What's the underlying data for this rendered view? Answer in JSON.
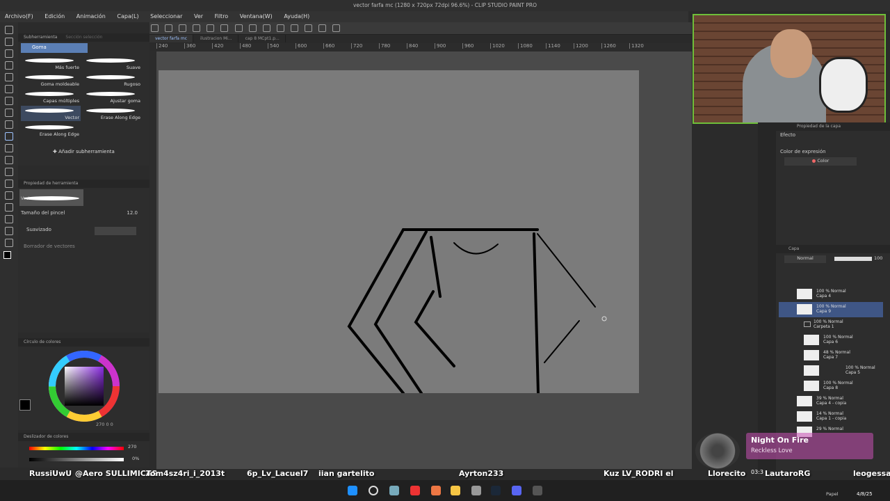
{
  "window": {
    "title": "vector farfa mc (1280 x 720px 72dpi 96.6%) - CLIP STUDIO PAINT PRO"
  },
  "menu": [
    "Archivo(F)",
    "Edición",
    "Animación",
    "Capa(L)",
    "Seleccionar",
    "Ver",
    "Filtro",
    "Ventana(W)",
    "Ayuda(H)"
  ],
  "tabs": [
    "vector farfa mc",
    "ilustracion Mi...",
    "cap 8 MCpt1.p..."
  ],
  "ruler": [
    "240",
    "360",
    "420",
    "480",
    "540",
    "600",
    "660",
    "720",
    "780",
    "840",
    "900",
    "960",
    "1020",
    "1080",
    "1140",
    "1200",
    "1260",
    "1320"
  ],
  "subtool": {
    "tabs": [
      "Subherramienta",
      "Sección selección"
    ],
    "group": "Goma",
    "brushes": [
      "Más fuerte",
      "Suave",
      "Goma moldeable",
      "Rugoso",
      "Capas múltiples",
      "Ajustar goma",
      "Vector",
      "Erase Along Edge",
      "Erase Along Edge"
    ],
    "add": "Añadir subherramienta"
  },
  "toolprop": {
    "title": "Propiedad de herramienta",
    "preset": "Vector",
    "size_label": "Tamaño del pincel",
    "size_value": "12.0",
    "smooth_label": "Suavizado",
    "vector_label": "Borrador de vectores"
  },
  "color": {
    "title": "Círculo de colores",
    "readout": "270  0  0",
    "slider_title": "Deslizador de colores",
    "slider_h": "270",
    "slider_v": "0%"
  },
  "layerprop": {
    "title": "Propiedad de la capa",
    "effect": "Efecto",
    "expr_label": "Color de expresión",
    "expr_value": "Color"
  },
  "layers": {
    "title": "Capa",
    "blend": "Normal",
    "opacity": "100",
    "items": [
      {
        "pct": "100 % Normal",
        "name": "Capa 4"
      },
      {
        "pct": "100 % Normal",
        "name": "Capa 9"
      },
      {
        "pct": "100 % Normal",
        "name": "Carpeta 1"
      },
      {
        "pct": "100 % Normal",
        "name": "Capa 6"
      },
      {
        "pct": "48 % Normal",
        "name": "Capa 7"
      },
      {
        "pct": "100 % Normal",
        "name": "Capa 5"
      },
      {
        "pct": "100 % Normal",
        "name": "Capa 8"
      },
      {
        "pct": "39 % Normal",
        "name": "Capa 4 - copia"
      },
      {
        "pct": "14 % Normal",
        "name": "Capa 1 - copia"
      },
      {
        "pct": "29 % Normal",
        "name": ""
      }
    ],
    "paper": "Papel"
  },
  "nowplaying": {
    "title": "Night On Fire",
    "artist": "Reckless Love"
  },
  "chat": [
    "RussiUwU",
    "@Aero SULLIMICAS",
    "Tom4sz4ri_i_2013t",
    "6p_Lv_Lacuel7",
    "iian gartelito",
    "Ayrton233",
    "Kuz LV_RODRI el",
    "Llorecito",
    "LautaroRG",
    "leogessa a"
  ],
  "clock": {
    "time": "03:3",
    "date": "4/8/25"
  }
}
